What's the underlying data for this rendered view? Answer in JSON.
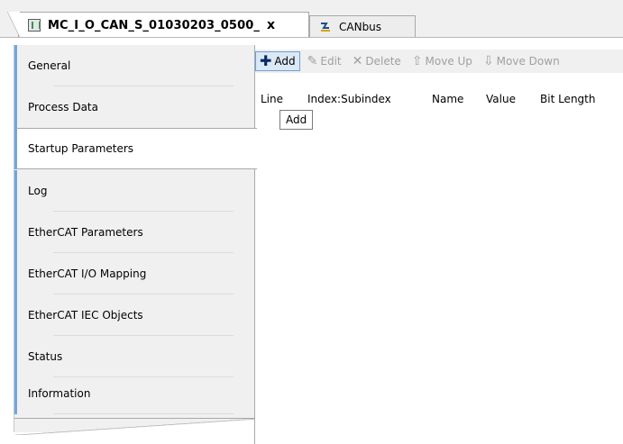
{
  "tabs": {
    "active_label": "MC_I_O_CAN_S_01030203_0500_",
    "close_glyph": "x",
    "inactive_label": "CANbus"
  },
  "nav": {
    "items": [
      {
        "label": "General"
      },
      {
        "label": "Process Data"
      },
      {
        "label": "Startup Parameters"
      },
      {
        "label": "Log"
      },
      {
        "label": "EtherCAT Parameters"
      },
      {
        "label": "EtherCAT I/O Mapping"
      },
      {
        "label": "EtherCAT IEC Objects"
      },
      {
        "label": "Status"
      },
      {
        "label": "Information"
      }
    ],
    "selected": "Startup Parameters"
  },
  "toolbar": {
    "add": "Add",
    "edit": "Edit",
    "delete": "Delete",
    "move_up": "Move Up",
    "move_down": "Move Down"
  },
  "grid": {
    "columns": [
      "Line",
      "Index:Subindex",
      "Name",
      "Value",
      "Bit Length"
    ]
  },
  "tooltip": {
    "text": "Add"
  },
  "colors": {
    "nav_accent": "#6fa8dc",
    "active_button_bg": "#dbe8f6",
    "active_button_border": "#6f9fd0"
  },
  "icons": {
    "tab_device": "device-icon",
    "tab_canbus": "canbus-icon",
    "add": "plus-icon",
    "edit": "edit-icon",
    "delete": "delete-icon",
    "move_up": "arrow-up-icon",
    "move_down": "arrow-down-icon"
  }
}
